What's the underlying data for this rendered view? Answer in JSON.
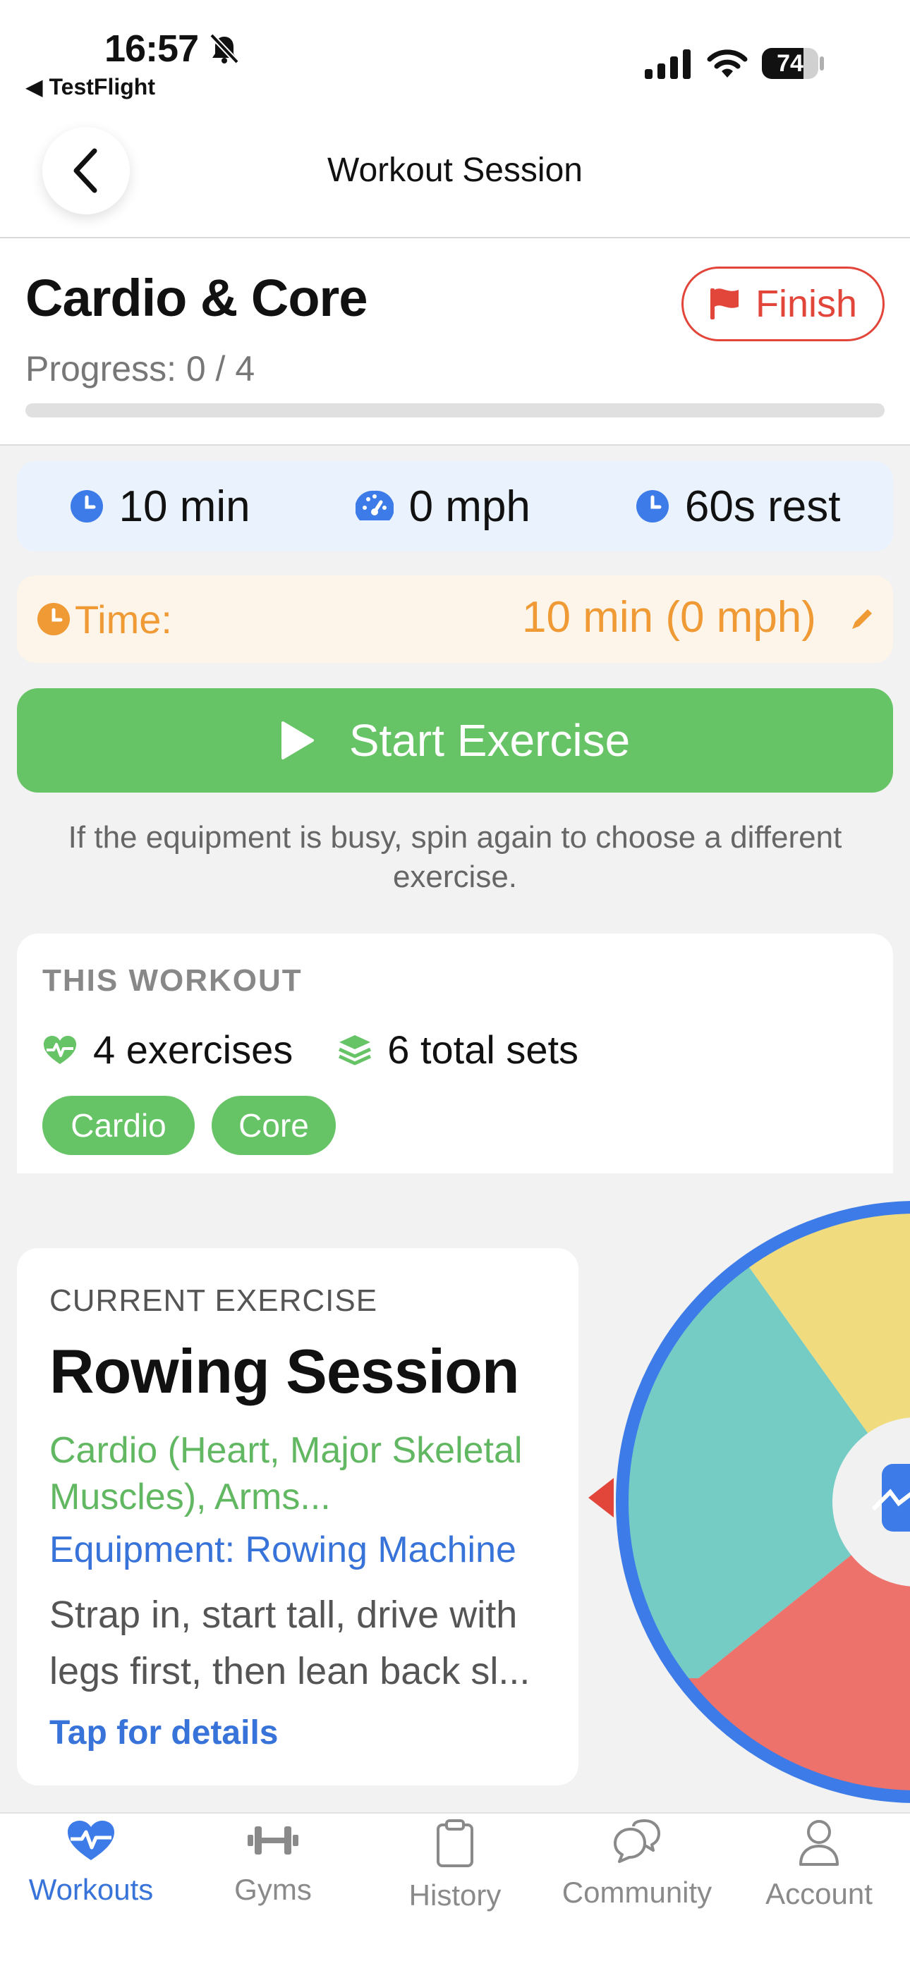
{
  "status": {
    "time": "16:57",
    "back_app": "◀ TestFlight",
    "battery": "74"
  },
  "nav": {
    "title": "Workout Session"
  },
  "header": {
    "title": "Cardio & Core",
    "finish_label": "Finish",
    "progress_text": "Progress: 0 / 4",
    "progress_fraction": 0
  },
  "stats": [
    {
      "icon": "clock-icon",
      "label": "10 min"
    },
    {
      "icon": "speedometer-icon",
      "label": "0 mph"
    },
    {
      "icon": "clock-icon",
      "label": "60s rest"
    }
  ],
  "time_row": {
    "label": "Time:",
    "value": "10 min (0 mph)",
    "edit_icon": "pencil-icon"
  },
  "start": {
    "label": "Start Exercise",
    "hint": "If the equipment is busy, spin again to choose a different exercise."
  },
  "this_workout": {
    "heading": "THIS WORKOUT",
    "exercises": "4 exercises",
    "sets": "6 total sets",
    "tags": [
      "Cardio",
      "Core"
    ]
  },
  "current_exercise": {
    "heading": "CURRENT EXERCISE",
    "title": "Rowing Session",
    "muscles": "Cardio (Heart, Major Skeletal Muscles), Arms...",
    "equipment": "Equipment: Rowing Machine",
    "description": "Strap in, start tall, drive with legs first, then lean back sl...",
    "details_link": "Tap for details"
  },
  "wheel": {
    "colors": [
      "#f0dc7e",
      "#74ccc4",
      "#ec726b"
    ],
    "rim_color": "#3c7be8"
  },
  "tabs": [
    {
      "label": "Workouts",
      "icon": "heart-pulse-icon",
      "active": true
    },
    {
      "label": "Gyms",
      "icon": "dumbbell-icon",
      "active": false
    },
    {
      "label": "History",
      "icon": "clipboard-icon",
      "active": false
    },
    {
      "label": "Community",
      "icon": "chat-bubbles-icon",
      "active": false
    },
    {
      "label": "Account",
      "icon": "person-icon",
      "active": false
    }
  ],
  "colors": {
    "accent_blue": "#3773d8",
    "green": "#66c466",
    "orange": "#ef9a35",
    "red": "#e2463a"
  }
}
